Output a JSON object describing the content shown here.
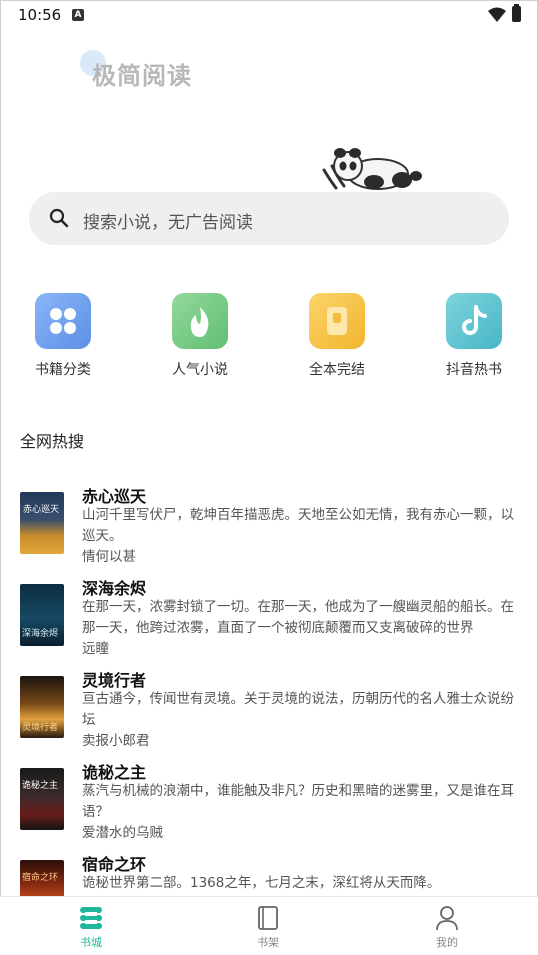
{
  "status_bar": {
    "time": "10:56",
    "notification_icon": "A"
  },
  "header": {
    "logo_text": "极简阅读"
  },
  "search": {
    "placeholder": "搜索小说，无广告阅读"
  },
  "categories": [
    {
      "label": "书籍分类",
      "icon": "grid-icon",
      "color": "#6a9ef0"
    },
    {
      "label": "人气小说",
      "icon": "flame-icon",
      "color": "#7ccf86"
    },
    {
      "label": "全本完结",
      "icon": "book-icon",
      "color": "#f6c24d"
    },
    {
      "label": "抖音热书",
      "icon": "tiktok-icon",
      "color": "#5fc4d1"
    }
  ],
  "hot_search": {
    "title": "全网热搜",
    "books": [
      {
        "title": "赤心巡天",
        "desc": "山河千里写伏尸，乾坤百年描恶虎。天地至公如无情，我有赤心一颗，以巡天。",
        "author": "情何以甚",
        "cover_text": "赤心巡天"
      },
      {
        "title": "深海余烬",
        "desc": "在那一天，浓雾封锁了一切。在那一天，他成为了一艘幽灵船的船长。在那一天，他跨过浓雾，直面了一个被彻底颠覆而又支离破碎的世界",
        "author": "远瞳",
        "cover_text": "深海余烬"
      },
      {
        "title": "灵境行者",
        "desc": "亘古通今，传闻世有灵境。关于灵境的说法，历朝历代的名人雅士众说纷坛",
        "author": "卖报小郎君",
        "cover_text": "灵境行者"
      },
      {
        "title": "诡秘之主",
        "desc": "蒸汽与机械的浪潮中，谁能触及非凡？历史和黑暗的迷雾里，又是谁在耳语？",
        "author": "爱潜水的乌贼",
        "cover_text": "诡秘之主"
      },
      {
        "title": "宿命之环",
        "desc": "诡秘世界第二部。1368之年，七月之末，深红将从天而降。",
        "author": "",
        "cover_text": "宿命之环"
      }
    ]
  },
  "bottom_nav": [
    {
      "label": "书城",
      "active": true
    },
    {
      "label": "书架",
      "active": false
    },
    {
      "label": "我的",
      "active": false
    }
  ],
  "colors": {
    "accent": "#1fb79a"
  }
}
